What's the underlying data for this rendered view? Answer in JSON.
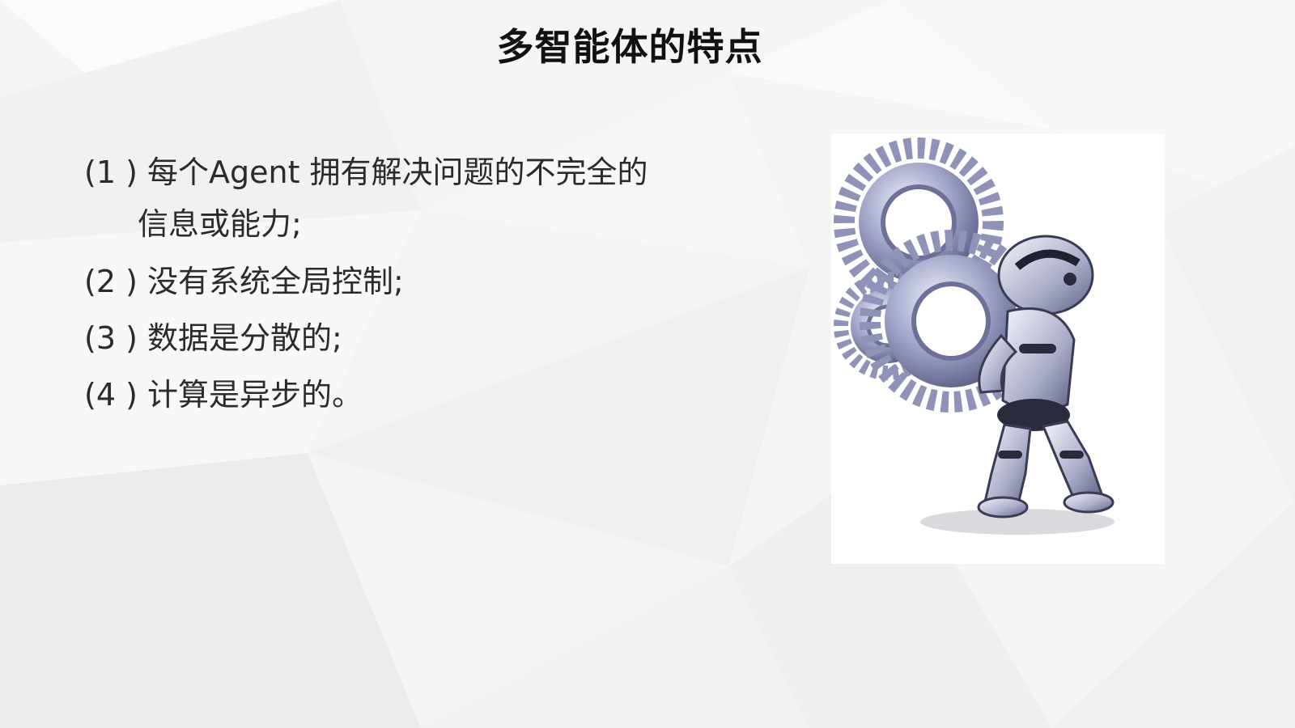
{
  "slide": {
    "title": "多智能体的特点",
    "bullets": [
      {
        "num": "(1 )",
        "text": "每个Agent 拥有解决问题的不完全的"
      },
      {
        "num": "",
        "text": "信息或能力;"
      },
      {
        "num": "(2 )",
        "text": "没有系统全局控制;"
      },
      {
        "num": "(3 )",
        "text": "数据是分散的;"
      },
      {
        "num": "(4 )",
        "text": "计算是异步的。"
      }
    ]
  },
  "image": {
    "icon": "robot-with-gears-icon"
  },
  "colors": {
    "background": "#f5f5f6",
    "text": "#2b2b2b",
    "title": "#111111",
    "gear_metal": "#8f93b8"
  }
}
